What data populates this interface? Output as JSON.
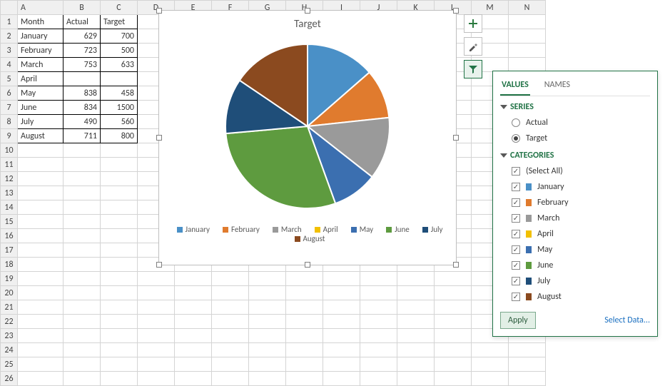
{
  "columns": [
    "A",
    "B",
    "C",
    "D",
    "E",
    "F",
    "G",
    "H",
    "I",
    "J",
    "K",
    "L",
    "M",
    "N"
  ],
  "rows": 26,
  "table": {
    "headers": [
      "Month",
      "Actual",
      "Target"
    ],
    "data": [
      {
        "month": "January",
        "actual": 629,
        "target": 700
      },
      {
        "month": "February",
        "actual": 723,
        "target": 500
      },
      {
        "month": "March",
        "actual": 753,
        "target": 633
      },
      {
        "month": "April",
        "actual": "",
        "target": ""
      },
      {
        "month": "May",
        "actual": 838,
        "target": 458
      },
      {
        "month": "June",
        "actual": 834,
        "target": 1500
      },
      {
        "month": "July",
        "actual": 490,
        "target": 560
      },
      {
        "month": "August",
        "actual": 711,
        "target": 800
      }
    ]
  },
  "chart_data": {
    "type": "pie",
    "title": "Target",
    "categories": [
      "January",
      "February",
      "March",
      "April",
      "May",
      "June",
      "July",
      "August"
    ],
    "values": [
      700,
      500,
      633,
      0,
      458,
      1500,
      560,
      800
    ],
    "colors": [
      "#4a90c7",
      "#e07b2e",
      "#9a9a9a",
      "#f2c000",
      "#3b6fb0",
      "#5e9b3f",
      "#1f4e79",
      "#8b4a1f"
    ]
  },
  "legend": {
    "items": [
      {
        "label": "January",
        "color": "#4a90c7"
      },
      {
        "label": "February",
        "color": "#e07b2e"
      },
      {
        "label": "March",
        "color": "#9a9a9a"
      },
      {
        "label": "April",
        "color": "#f2c000"
      },
      {
        "label": "May",
        "color": "#3b6fb0"
      },
      {
        "label": "June",
        "color": "#5e9b3f"
      },
      {
        "label": "July",
        "color": "#1f4e79"
      },
      {
        "label": "August",
        "color": "#8b4a1f"
      }
    ]
  },
  "side_buttons": {
    "plus_icon": "plus-icon",
    "brush_icon": "brush-icon",
    "filter_icon": "funnel-icon"
  },
  "filter_panel": {
    "tabs": {
      "values": "VALUES",
      "names": "NAMES"
    },
    "series_header": "SERIES",
    "categories_header": "CATEGORIES",
    "series": [
      {
        "label": "Actual",
        "checked": false
      },
      {
        "label": "Target",
        "checked": true
      }
    ],
    "select_all_label": "(Select All)",
    "categories": [
      {
        "label": "January",
        "color": "#4a90c7",
        "checked": true
      },
      {
        "label": "February",
        "color": "#e07b2e",
        "checked": true
      },
      {
        "label": "March",
        "color": "#9a9a9a",
        "checked": true
      },
      {
        "label": "April",
        "color": "#f2c000",
        "checked": true
      },
      {
        "label": "May",
        "color": "#3b6fb0",
        "checked": true
      },
      {
        "label": "June",
        "color": "#5e9b3f",
        "checked": true
      },
      {
        "label": "July",
        "color": "#1f4e79",
        "checked": true
      },
      {
        "label": "August",
        "color": "#8b4a1f",
        "checked": true
      }
    ],
    "apply_label": "Apply",
    "select_data_label": "Select Data..."
  }
}
